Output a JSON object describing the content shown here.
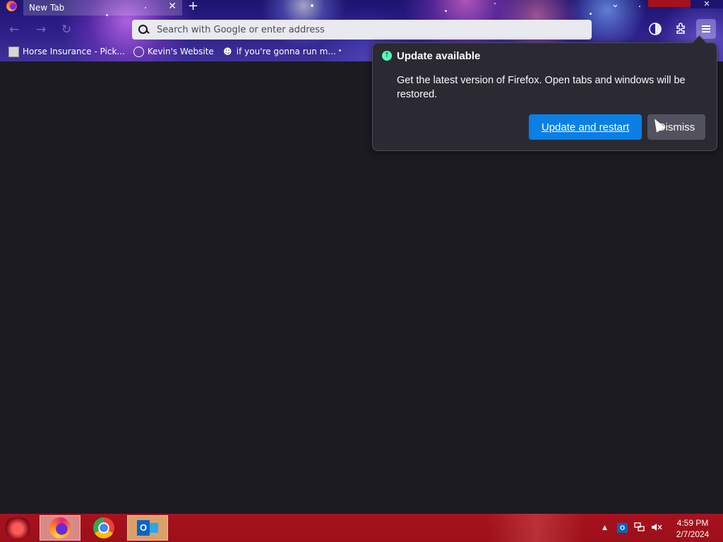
{
  "browser": {
    "tab": {
      "title": "New Tab",
      "close_glyph": "✕"
    },
    "new_tab_glyph": "+",
    "list_tabs_glyph": "⌄",
    "window_close_glyph": "✕",
    "nav": {
      "back_glyph": "←",
      "forward_glyph": "→",
      "reload_glyph": "↻"
    },
    "urlbar": {
      "placeholder": "Search with Google or enter address",
      "value": ""
    },
    "toolbar_icons": [
      "account-icon",
      "extensions-icon",
      "menu-icon"
    ],
    "bookmarks": [
      {
        "label": "Horse Insurance - Pick...",
        "icon": "horse-favicon"
      },
      {
        "label": "Kevin's Website",
        "icon": "globe-icon"
      },
      {
        "label": "if you're gonna run m...",
        "icon": "mask-favicon"
      }
    ]
  },
  "update_popup": {
    "title": "Update available",
    "body": "Get the latest version of Firefox. Open tabs and windows will be restored.",
    "primary_button": "Update and restart",
    "secondary_button": "Dismiss",
    "icon": "update-arrow-icon",
    "icon_color": "#54ffbd"
  },
  "taskbar": {
    "apps": [
      "firefox",
      "chrome",
      "outlook"
    ],
    "tray_expand_glyph": "▲",
    "clock": {
      "time": "4:59 PM",
      "date": "2/7/2024"
    }
  },
  "colors": {
    "accent_button": "#0a7fe5",
    "taskbar": "#a6121e",
    "content_bg": "#1c1b22",
    "popup_bg": "#2b2a33"
  }
}
